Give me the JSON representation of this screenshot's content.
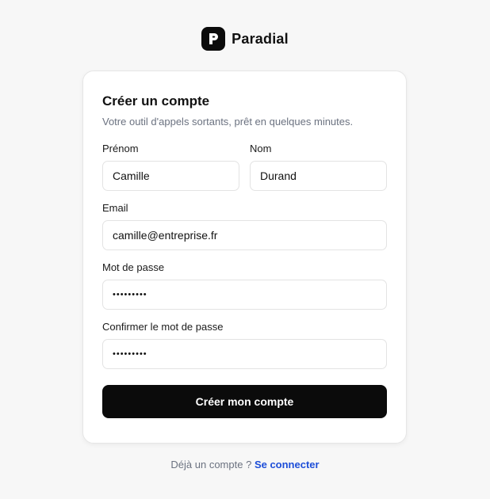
{
  "brand": {
    "name": "Paradial",
    "logo_icon": "paradial-p-logo-icon",
    "logo_color": "#0b0b0b"
  },
  "card": {
    "title": "Créer un compte",
    "subtitle": "Votre outil d'appels sortants, prêt en quelques minutes."
  },
  "form": {
    "first_name": {
      "label": "Prénom",
      "value": "Camille"
    },
    "last_name": {
      "label": "Nom",
      "value": "Durand"
    },
    "email": {
      "label": "Email",
      "value": "camille@entreprise.fr"
    },
    "password": {
      "label": "Mot de passe",
      "value": "•••••••••"
    },
    "confirm_password": {
      "label": "Confirmer le mot de passe",
      "value": "•••••••••"
    },
    "submit_label": "Créer mon compte",
    "submit_color": "#0b0b0b"
  },
  "footer": {
    "text": "Déjà un compte ?",
    "link_label": "Se connecter",
    "link_color": "#1d4ed8"
  }
}
